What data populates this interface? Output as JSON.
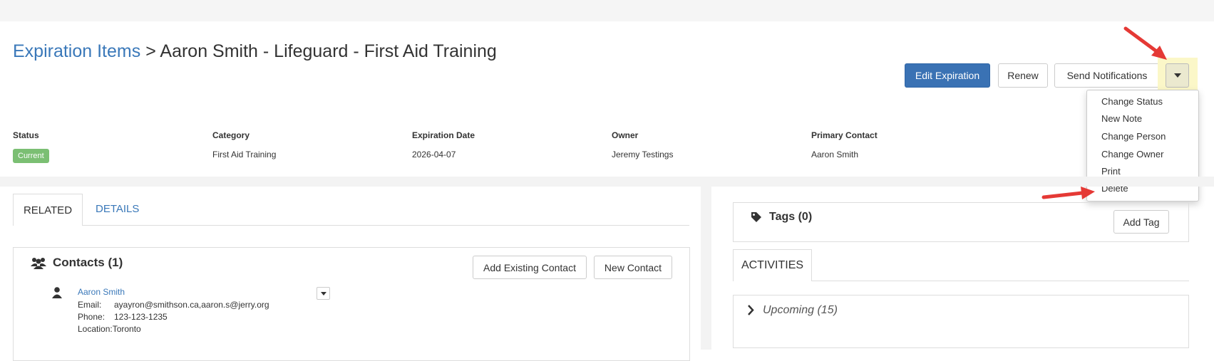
{
  "breadcrumb": {
    "parent": "Expiration Items",
    "separator": ">",
    "current": "Aaron Smith - Lifeguard - First Aid Training"
  },
  "actions": {
    "edit": "Edit Expiration",
    "renew": "Renew",
    "send": "Send Notifications",
    "more_icon": "caret-down-icon"
  },
  "dropdown_menu": {
    "items": [
      "Change Status",
      "New Note",
      "Change Person",
      "Change Owner",
      "Print",
      "Delete"
    ]
  },
  "summary": {
    "status": {
      "label": "Status",
      "value": "Current"
    },
    "category": {
      "label": "Category",
      "value": "First Aid Training"
    },
    "expiration_date": {
      "label": "Expiration Date",
      "value": "2026-04-07"
    },
    "owner": {
      "label": "Owner",
      "value": "Jeremy Testings"
    },
    "primary_contact": {
      "label": "Primary Contact",
      "value": "Aaron Smith"
    }
  },
  "tabs": {
    "related": "RELATED",
    "details": "DETAILS"
  },
  "contacts": {
    "title": "Contacts (1)",
    "add_existing": "Add Existing Contact",
    "new_contact": "New Contact",
    "items": [
      {
        "name": "Aaron Smith",
        "email_label": "Email:",
        "email": "ayayron@smithson.ca,aaron.s@jerry.org",
        "phone_label": "Phone:",
        "phone": "123-123-1235",
        "location": "Location:Toronto"
      }
    ]
  },
  "tags": {
    "title": "Tags (0)",
    "add": "Add Tag"
  },
  "activities": {
    "tab": "ACTIVITIES",
    "upcoming": "Upcoming (15)"
  },
  "colors": {
    "link": "#3a78b9",
    "primary_button": "#3a72b4",
    "status_badge": "#7bbf73",
    "highlight": "#fbf7c8",
    "annotation_arrow": "#e53935"
  }
}
